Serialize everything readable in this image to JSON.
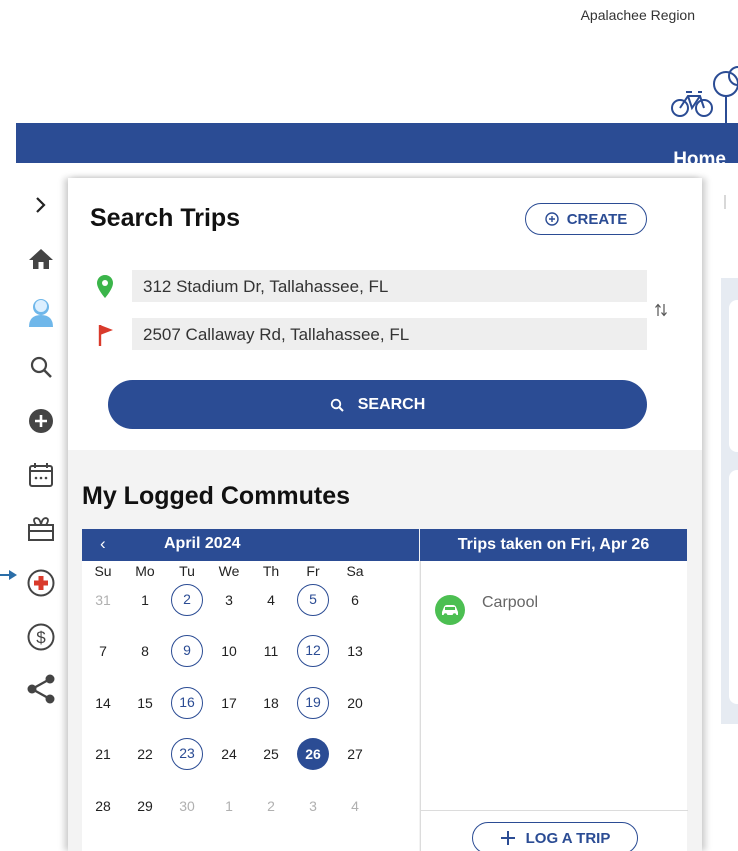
{
  "header": {
    "region": "Apalachee Region",
    "nav_home": "Home"
  },
  "colors": {
    "brand": "#2b4c94",
    "origin_pin": "#3bb54a",
    "destination_flag": "#d93a2b",
    "carpool": "#4cbf52"
  },
  "sidebar": {
    "items": [
      {
        "name": "expand",
        "icon": "chevron-right-icon"
      },
      {
        "name": "home",
        "icon": "home-icon"
      },
      {
        "name": "profile",
        "icon": "user-avatar-icon"
      },
      {
        "name": "search",
        "icon": "search-icon"
      },
      {
        "name": "add",
        "icon": "plus-circle-icon"
      },
      {
        "name": "calendar",
        "icon": "calendar-icon"
      },
      {
        "name": "rewards",
        "icon": "gift-icon"
      },
      {
        "name": "emergency",
        "icon": "medical-cross-icon"
      },
      {
        "name": "savings",
        "icon": "dollar-circle-icon"
      },
      {
        "name": "share",
        "icon": "share-icon"
      }
    ]
  },
  "search": {
    "title": "Search Trips",
    "create_label": "CREATE",
    "origin": "312 Stadium Dr, Tallahassee, FL",
    "destination": "2507 Callaway Rd, Tallahassee, FL",
    "search_label": "SEARCH"
  },
  "commutes": {
    "title": "My Logged Commutes",
    "calendar": {
      "prev": "‹",
      "month": "April 2024",
      "weekdays": [
        "Su",
        "Mo",
        "Tu",
        "We",
        "Th",
        "Fr",
        "Sa"
      ],
      "weeks": [
        [
          "31",
          "1",
          "2",
          "3",
          "4",
          "5",
          "6"
        ],
        [
          "7",
          "8",
          "9",
          "10",
          "11",
          "12",
          "13"
        ],
        [
          "14",
          "15",
          "16",
          "17",
          "18",
          "19",
          "20"
        ],
        [
          "21",
          "22",
          "23",
          "24",
          "25",
          "26",
          "27"
        ],
        [
          "28",
          "29",
          "30",
          "1",
          "2",
          "3",
          "4"
        ]
      ],
      "muted": [
        "0-0",
        "4-2",
        "4-3",
        "4-4",
        "4-5",
        "4-6"
      ],
      "logged": [
        "2",
        "5",
        "9",
        "12",
        "16",
        "19",
        "23"
      ],
      "selected": "26"
    },
    "trips": {
      "header": "Trips taken on Fri, Apr 26",
      "items": [
        {
          "label": "Carpool",
          "icon": "carpool-icon"
        }
      ],
      "log_label": "LOG A TRIP"
    }
  }
}
